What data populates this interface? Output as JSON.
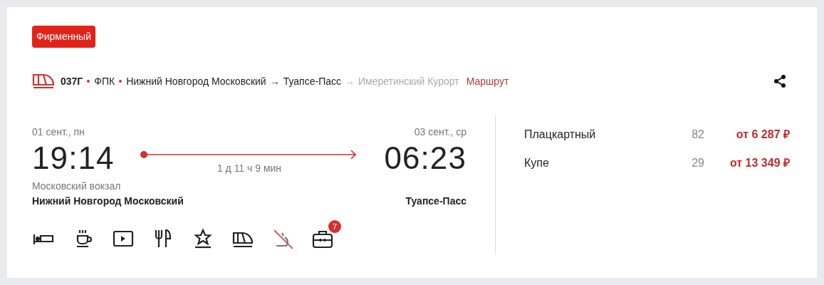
{
  "badge": "Фирменный",
  "route": {
    "number": "037Г",
    "carrier": "ФПК",
    "from": "Нижний Новгород Московский",
    "arrow": "→",
    "to": "Туапсе-Пасс",
    "arrow_2": "→",
    "final": "Имеретинский Курорт",
    "link": "Маршрут"
  },
  "departure": {
    "date": "01 сент., пн",
    "time": "19:14",
    "station_note": "Московский вокзал",
    "station": "Нижний Новгород Московский"
  },
  "duration": "1 д 11 ч 9 мин",
  "arrival": {
    "date": "03 сент., ср",
    "time": "06:23",
    "station": "Туапсе-Пасс"
  },
  "amenities": [
    {
      "kind": "bed",
      "available": true
    },
    {
      "kind": "coffee",
      "available": true
    },
    {
      "kind": "video",
      "available": true
    },
    {
      "kind": "food",
      "available": true
    },
    {
      "kind": "star",
      "available": true
    },
    {
      "kind": "train",
      "available": true
    },
    {
      "kind": "pet",
      "available": false
    },
    {
      "kind": "luggage",
      "available": true,
      "count": "7"
    }
  ],
  "fares": [
    {
      "class": "Плацкартный",
      "seats": "82",
      "price": "от 6 287 ₽"
    },
    {
      "class": "Купе",
      "seats": "29",
      "price": "от 13 349 ₽"
    }
  ]
}
